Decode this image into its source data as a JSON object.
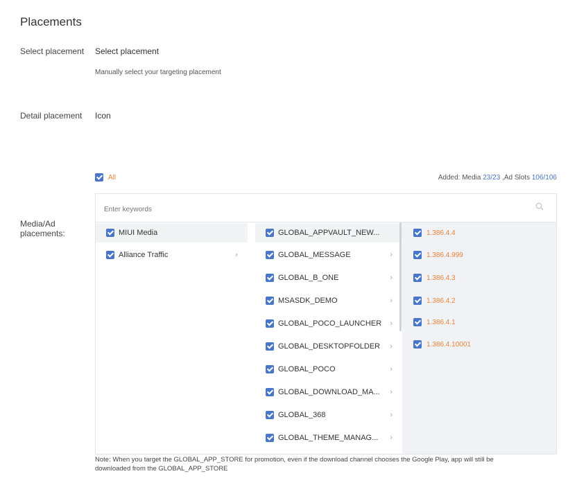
{
  "title": "Placements",
  "select_placement": {
    "label": "Select placement",
    "value": "Select placement",
    "hint": "Manually select your targeting placement"
  },
  "detail_placement": {
    "label": "Detail placement",
    "value": "Icon"
  },
  "all_label": "All",
  "added": {
    "prefix": "Added: Media ",
    "media_count": "23/23",
    "middle": " ,Ad Slots ",
    "slots_count": "106/106"
  },
  "media_label_line1": "Media/Ad",
  "media_label_line2": "placements:",
  "search": {
    "placeholder": "Enter keywords"
  },
  "col1_items": [
    {
      "label": "MIUI Media"
    },
    {
      "label": "Alliance Traffic"
    }
  ],
  "col2_items": [
    {
      "label": "GLOBAL_APPVAULT_NEW..."
    },
    {
      "label": "GLOBAL_MESSAGE"
    },
    {
      "label": "GLOBAL_B_ONE"
    },
    {
      "label": "MSASDK_DEMO"
    },
    {
      "label": "GLOBAL_POCO_LAUNCHER"
    },
    {
      "label": "GLOBAL_DESKTOPFOLDER"
    },
    {
      "label": "GLOBAL_POCO"
    },
    {
      "label": "GLOBAL_DOWNLOAD_MA..."
    },
    {
      "label": "GLOBAL_368"
    },
    {
      "label": "GLOBAL_THEME_MANAG..."
    }
  ],
  "col3_items": [
    {
      "label": "1.386.4.4"
    },
    {
      "label": "1.386.4.999"
    },
    {
      "label": "1.386.4.3"
    },
    {
      "label": "1.386.4.2"
    },
    {
      "label": "1.386.4.1"
    },
    {
      "label": "1.386.4.10001"
    }
  ],
  "note_line1": "Note: When you target the GLOBAL_APP_STORE for promotion, even if the download channel chooses the Google Play, app will still be",
  "note_line2": "downloaded from the GLOBAL_APP_STORE",
  "colors": {
    "accent": "#4a76c7",
    "orange": "#e8833a"
  }
}
